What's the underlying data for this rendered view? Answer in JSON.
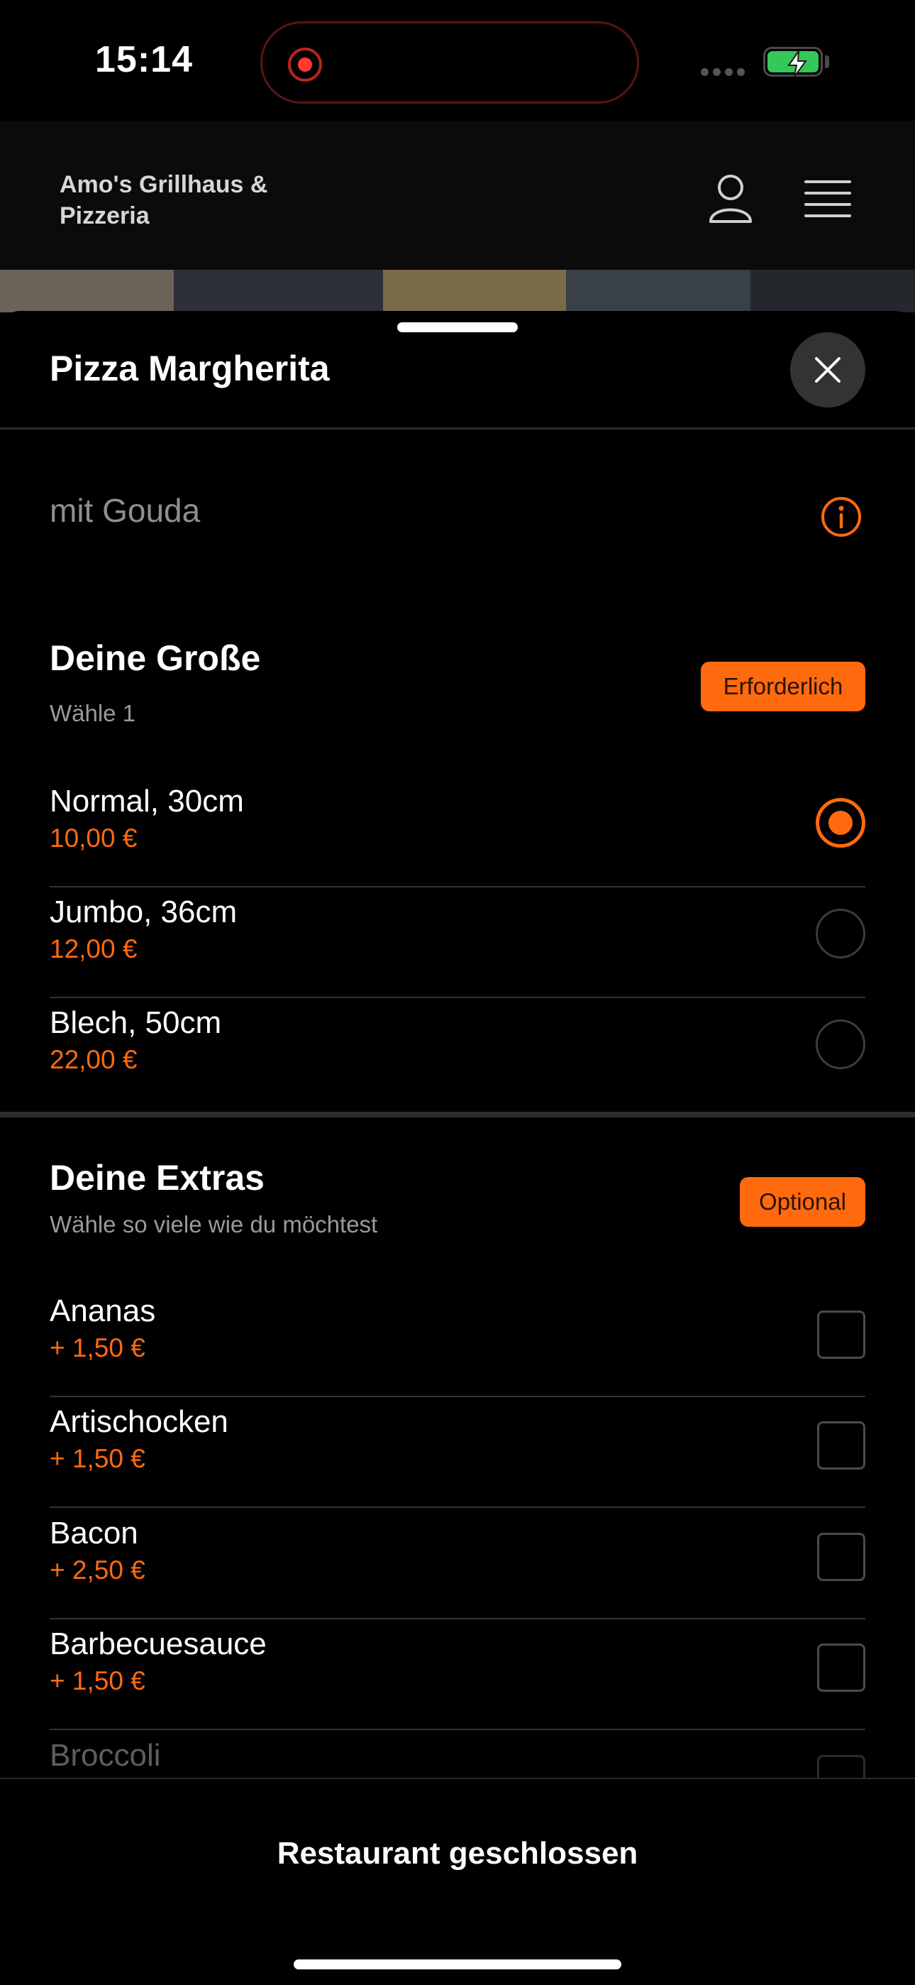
{
  "status_bar": {
    "time": "15:14"
  },
  "header": {
    "restaurant_name": "Amo's Grillhaus & Pizzeria"
  },
  "sheet": {
    "title": "Pizza Margherita",
    "description": "mit Gouda"
  },
  "size_section": {
    "title": "Deine Große",
    "subtitle": "Wähle 1",
    "badge": "Erforderlich",
    "options": [
      {
        "name": "Normal, 30cm",
        "price": "10,00 €",
        "selected": true
      },
      {
        "name": "Jumbo, 36cm",
        "price": "12,00 €",
        "selected": false
      },
      {
        "name": "Blech, 50cm",
        "price": "22,00 €",
        "selected": false
      }
    ]
  },
  "extras_section": {
    "title": "Deine Extras",
    "subtitle": "Wähle so viele wie du möchtest",
    "badge": "Optional",
    "options": [
      {
        "name": "Ananas",
        "price": "+ 1,50 €",
        "checked": false
      },
      {
        "name": "Artischocken",
        "price": "+ 1,50 €",
        "checked": false
      },
      {
        "name": "Bacon",
        "price": "+ 2,50 €",
        "checked": false
      },
      {
        "name": "Barbecuesauce",
        "price": "+ 1,50 €",
        "checked": false
      },
      {
        "name": "Broccoli",
        "checked": false
      }
    ]
  },
  "footer": {
    "label": "Restaurant geschlossen"
  },
  "colors": {
    "accent": "#ff6a0f",
    "background": "#000000",
    "divider": "#2c2c2c"
  }
}
